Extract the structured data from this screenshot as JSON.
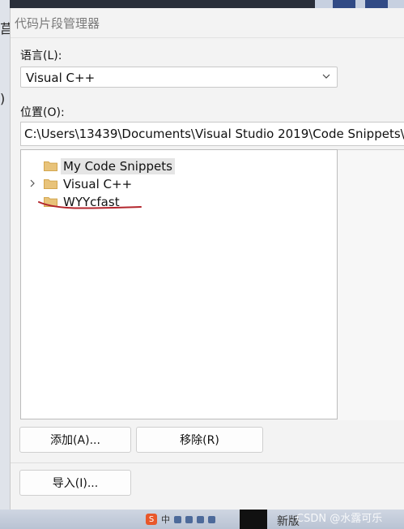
{
  "background": {
    "left_fragment": "莒",
    "left_fragment2": ")"
  },
  "dialog": {
    "title": "代码片段管理器",
    "language_label": "语言(L):",
    "language_value": "Visual C++",
    "location_label": "位置(O):",
    "location_value": "C:\\Users\\13439\\Documents\\Visual Studio 2019\\Code Snippets\\Vi",
    "tree": [
      {
        "name": "My Code Snippets",
        "selected": true,
        "expandable": false
      },
      {
        "name": "Visual C++",
        "selected": false,
        "expandable": true
      },
      {
        "name": "WYYcfast",
        "selected": false,
        "expandable": false
      }
    ],
    "add_button": "添加(A)...",
    "remove_button": "移除(R)",
    "import_button": "导入(I)..."
  },
  "taskbar": {
    "ime_mode": "中",
    "new_label": "新版"
  },
  "watermark": "CSDN @水露可乐",
  "colors": {
    "folder": "#e8c37a",
    "annotation": "#b3262d"
  }
}
